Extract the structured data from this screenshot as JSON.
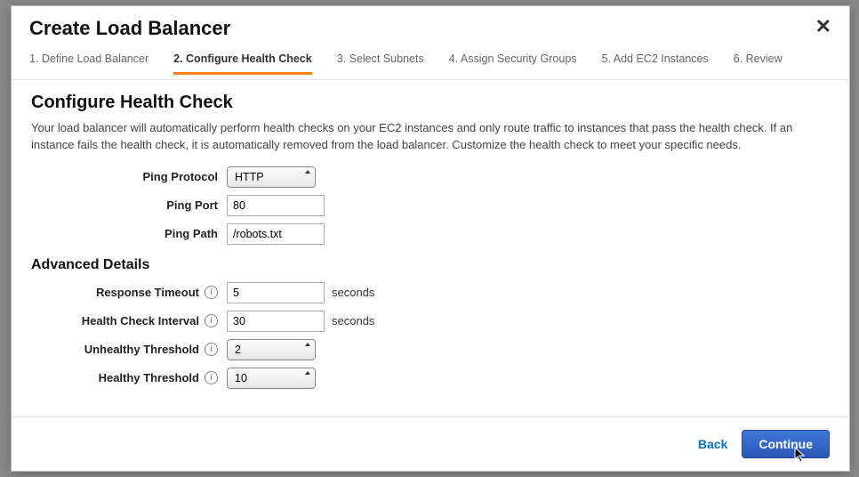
{
  "modal": {
    "title": "Create Load Balancer"
  },
  "steps": [
    {
      "label": "1. Define Load Balancer",
      "active": false
    },
    {
      "label": "2. Configure Health Check",
      "active": true
    },
    {
      "label": "3. Select Subnets",
      "active": false
    },
    {
      "label": "4. Assign Security Groups",
      "active": false
    },
    {
      "label": "5. Add EC2 Instances",
      "active": false
    },
    {
      "label": "6. Review",
      "active": false
    }
  ],
  "section": {
    "title": "Configure Health Check",
    "description": "Your load balancer will automatically perform health checks on your EC2 instances and only route traffic to instances that pass the health check. If an instance fails the health check, it is automatically removed from the load balancer. Customize the health check to meet your specific needs."
  },
  "form": {
    "ping_protocol": {
      "label": "Ping Protocol",
      "value": "HTTP"
    },
    "ping_port": {
      "label": "Ping Port",
      "value": "80"
    },
    "ping_path": {
      "label": "Ping Path",
      "value": "/robots.txt"
    }
  },
  "advanced": {
    "title": "Advanced Details",
    "response_timeout": {
      "label": "Response Timeout",
      "value": "5",
      "unit": "seconds"
    },
    "health_check_interval": {
      "label": "Health Check Interval",
      "value": "30",
      "unit": "seconds"
    },
    "unhealthy_threshold": {
      "label": "Unhealthy Threshold",
      "value": "2"
    },
    "healthy_threshold": {
      "label": "Healthy Threshold",
      "value": "10"
    }
  },
  "footer": {
    "back": "Back",
    "continue": "Continue"
  },
  "info_glyph": "i"
}
